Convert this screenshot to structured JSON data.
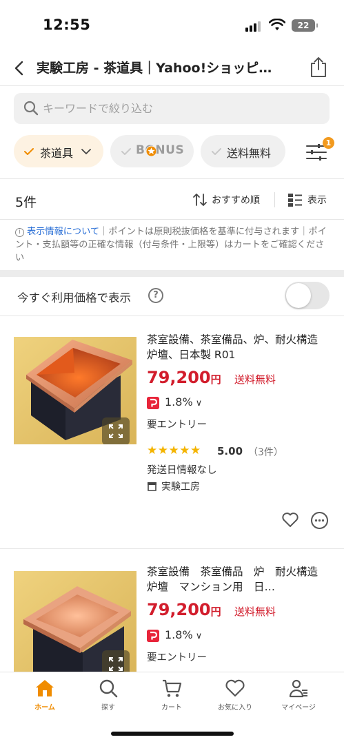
{
  "status_bar": {
    "time": "12:55",
    "battery": "22"
  },
  "header": {
    "title": "実験工房 - 茶道具｜Yahoo!ショッピ…"
  },
  "search": {
    "placeholder": "キーワードで絞り込む"
  },
  "filters": {
    "category_label": "茶道具",
    "bonus_label": "BONUS",
    "shipping_label": "送料無料",
    "filter_badge": "1"
  },
  "results": {
    "count": "5件",
    "sort_label": "おすすめ順",
    "view_label": "表示"
  },
  "notice": {
    "link_text": "表示情報について",
    "text": "｜ポイントは原則税抜価格を基準に付与されます｜ポイント・支払額等の正確な情報（付与条件・上限等）はカートをご確認ください"
  },
  "price_toggle": {
    "label": "今すぐ利用価格で表示",
    "on": false
  },
  "products": [
    {
      "title": "茶室設備、茶室備品、炉、耐火構造炉壇、日本製 R01",
      "price": "79,200",
      "currency": "円",
      "shipping": "送料無料",
      "paypay_rate": "1.8%",
      "entry": "要エントリー",
      "stars": "★★★★★",
      "rating": "5.00",
      "review_count": "（3件）",
      "ship_date": "発送日情報なし",
      "store": "実験工房"
    },
    {
      "title": "茶室設備　茶室備品　炉　耐火構造炉壇　マンション用　日…",
      "price": "79,200",
      "currency": "円",
      "shipping": "送料無料",
      "paypay_rate": "1.8%",
      "entry": "要エントリー"
    }
  ],
  "tabbar": {
    "home": "ホーム",
    "search": "探す",
    "cart": "カート",
    "favorites": "お気に入り",
    "mypage": "マイページ"
  },
  "colors": {
    "accent": "#f08c00",
    "price_red": "#d21d2c",
    "chip_active_bg": "#fdf2e2",
    "link_blue": "#2a6fd6"
  },
  "icons": [
    "back-icon",
    "share-icon",
    "search-icon",
    "check-icon",
    "chevron-down-icon",
    "filter-icon",
    "sort-icon",
    "list-view-icon",
    "info-icon",
    "help-icon",
    "expand-icon",
    "paypay-icon",
    "store-icon",
    "heart-icon",
    "more-icon",
    "home-icon",
    "cart-icon",
    "person-icon"
  ]
}
